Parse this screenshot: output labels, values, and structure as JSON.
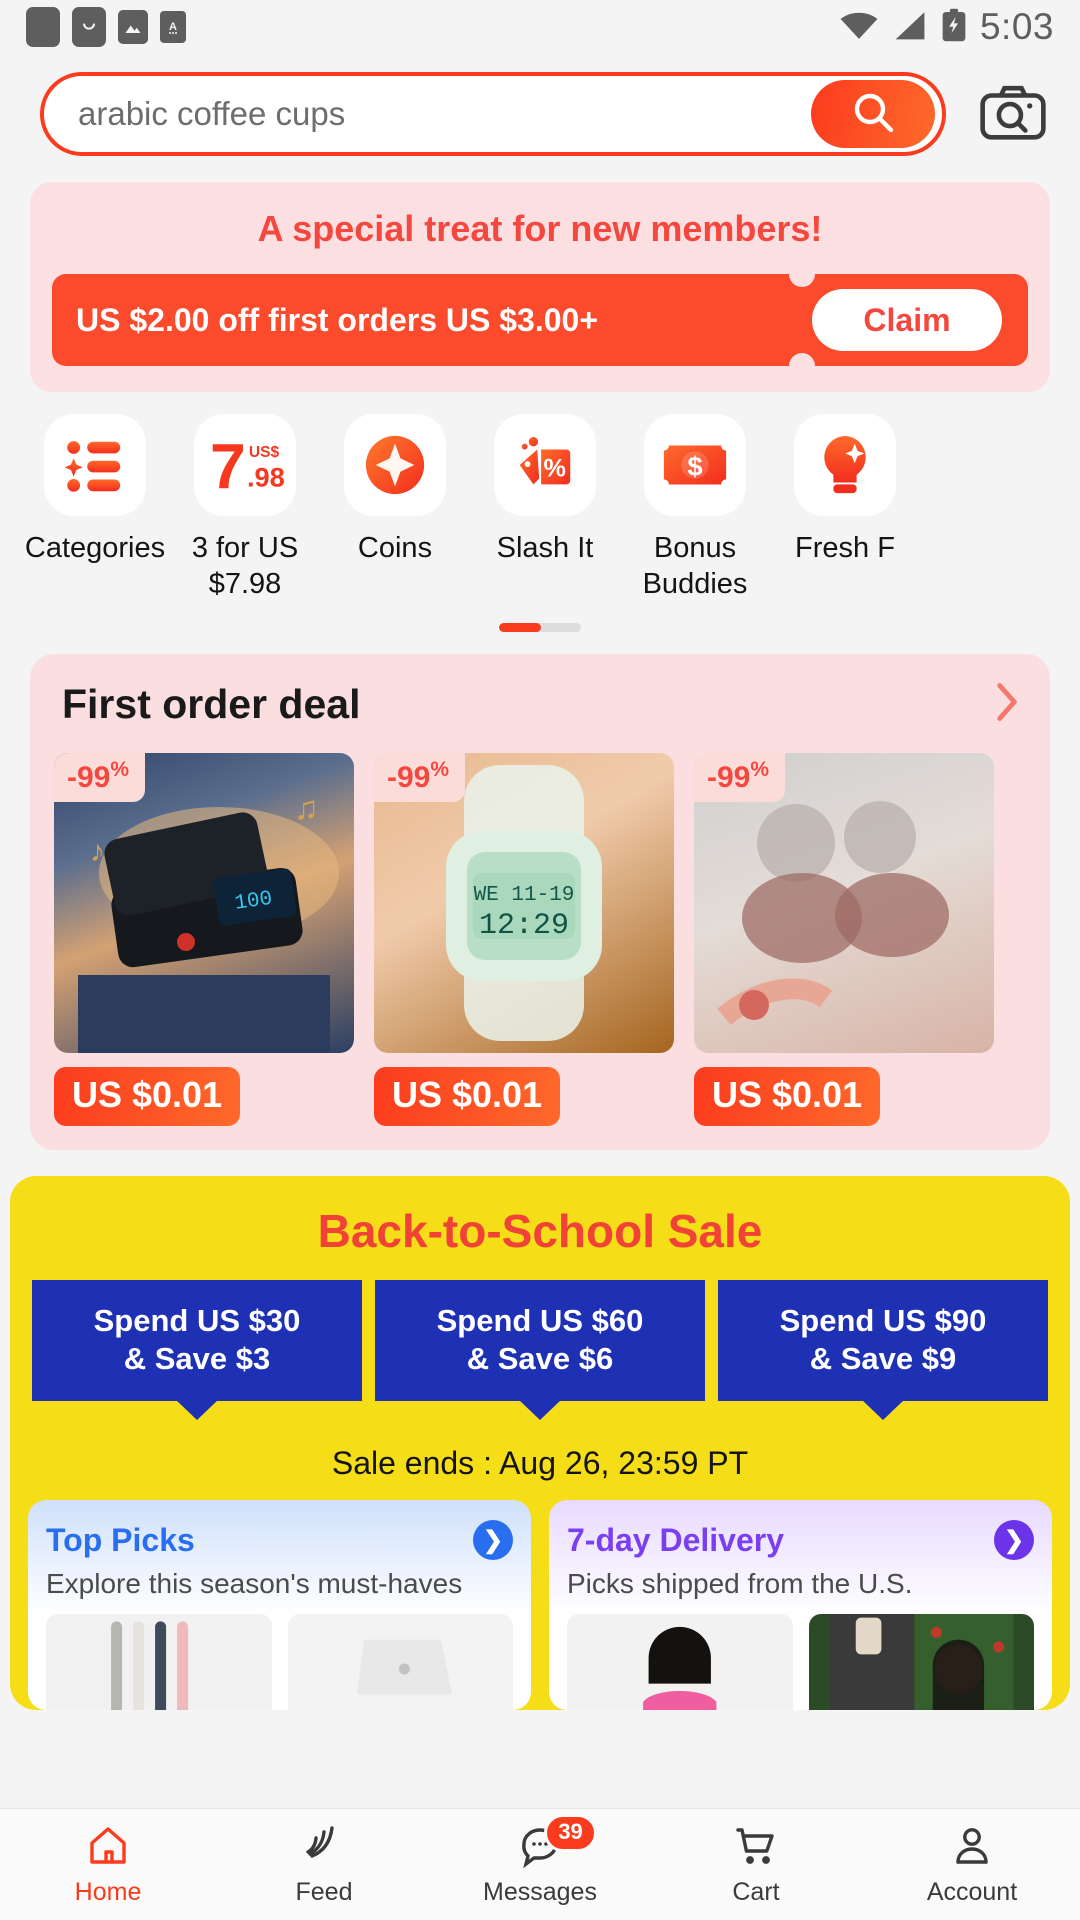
{
  "statusbar": {
    "time": "5:03",
    "left_icons": [
      "app-icon",
      "shopping-bag-icon",
      "photos-icon",
      "font-app-icon"
    ],
    "right_icons": [
      "wifi-icon",
      "cellular-signal-icon",
      "battery-charging-icon"
    ]
  },
  "search": {
    "value": "arabic coffee cups",
    "placeholder": "Search",
    "search_icon": "search-icon",
    "camera_icon": "camera-search-icon",
    "accent": "#fb3b1e"
  },
  "member_banner": {
    "title": "A special treat for new members!",
    "offer": "US $2.00 off first orders US $3.00+",
    "claim_label": "Claim",
    "bg": "#fcdfe0",
    "ticket_bg": "#fc4a2c"
  },
  "quick_links": [
    {
      "label": "Categories",
      "icon": "categories-icon"
    },
    {
      "label": "3 for US $7.98",
      "icon": "three-for-price-icon"
    },
    {
      "label": "Coins",
      "icon": "coins-icon"
    },
    {
      "label": "Slash It",
      "icon": "slash-it-tag-icon"
    },
    {
      "label": "Bonus Buddies",
      "icon": "bonus-cash-icon"
    },
    {
      "label": "Fresh F",
      "icon": "fresh-finds-bulb-icon"
    }
  ],
  "first_order_deal": {
    "title": "First order deal",
    "arrow_icon": "chevron-right-icon",
    "products": [
      {
        "discount": "-99",
        "discount_unit": "%",
        "price": "US $0.01",
        "image": "wireless-earbuds-charging-case"
      },
      {
        "discount": "-99",
        "discount_unit": "%",
        "price": "US $0.01",
        "image": "digital-sport-watch"
      },
      {
        "discount": "-99",
        "discount_unit": "%",
        "price": "US $0.01",
        "image": "bear-ear-sunglasses"
      }
    ]
  },
  "back_to_school": {
    "title": "Back-to-School Sale",
    "bg": "#f5de18",
    "title_color": "#f04237",
    "tiers": [
      {
        "line1": "Spend US $30",
        "line2": "& Save $3"
      },
      {
        "line1": "Spend US $60",
        "line2": "& Save $6"
      },
      {
        "line1": "Spend US $90",
        "line2": "& Save $9"
      }
    ],
    "sale_ends": "Sale ends : Aug 26, 23:59 PT",
    "subcards": [
      {
        "title": "Top Picks",
        "subtitle": "Explore this season's must-haves",
        "arrow_icon": "chevron-right-circle-icon",
        "color": "#2a6ef0",
        "thumbs": [
          "animal-gel-pens",
          "white-folded-item"
        ]
      },
      {
        "title": "7-day Delivery",
        "subtitle": "Picks shipped from the U.S.",
        "arrow_icon": "chevron-right-circle-icon",
        "color": "#7b3ff2",
        "thumbs": [
          "woman-pink-top-wig",
          "curly-hair-wig"
        ]
      }
    ]
  },
  "bottom_nav": [
    {
      "label": "Home",
      "icon": "home-icon",
      "active": true,
      "badge": ""
    },
    {
      "label": "Feed",
      "icon": "feed-icon",
      "active": false,
      "badge": ""
    },
    {
      "label": "Messages",
      "icon": "messages-icon",
      "active": false,
      "badge": "39"
    },
    {
      "label": "Cart",
      "icon": "cart-icon",
      "active": false,
      "badge": ""
    },
    {
      "label": "Account",
      "icon": "account-icon",
      "active": false,
      "badge": ""
    }
  ]
}
